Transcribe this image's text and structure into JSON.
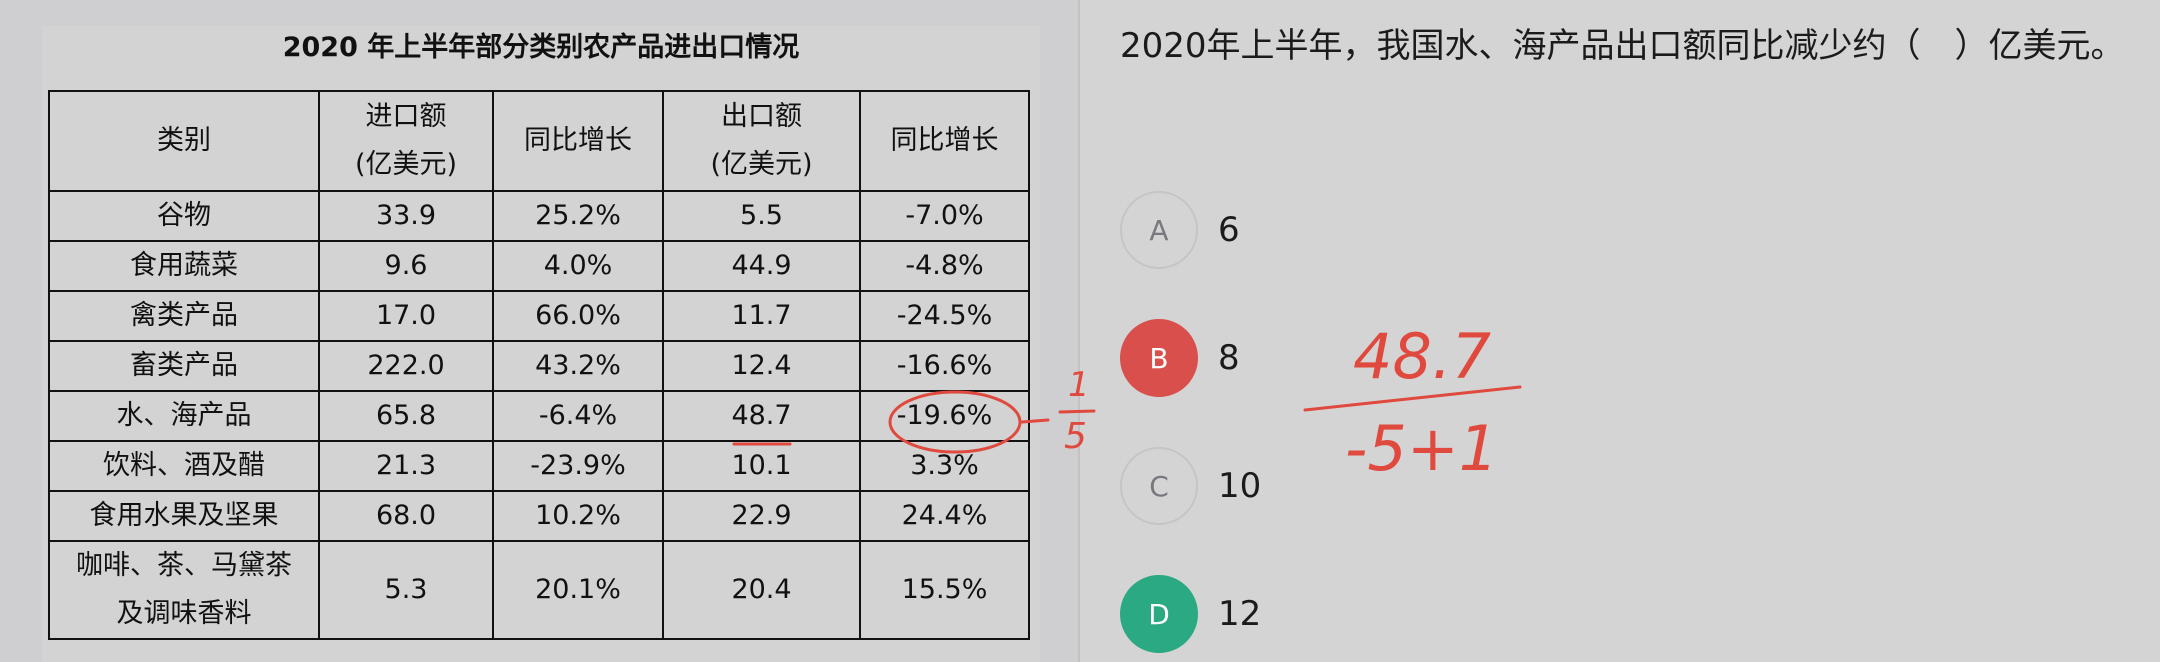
{
  "table": {
    "title": "2020 年上半年部分类别农产品进出口情况",
    "headers": [
      {
        "line1": "类别",
        "line2": ""
      },
      {
        "line1": "进口额",
        "line2": "(亿美元)"
      },
      {
        "line1": "同比增长",
        "line2": ""
      },
      {
        "line1": "出口额",
        "line2": "(亿美元)"
      },
      {
        "line1": "同比增长",
        "line2": ""
      }
    ],
    "rows": [
      [
        "谷物",
        "33.9",
        "25.2%",
        "5.5",
        "-7.0%"
      ],
      [
        "食用蔬菜",
        "9.6",
        "4.0%",
        "44.9",
        "-4.8%"
      ],
      [
        "禽类产品",
        "17.0",
        "66.0%",
        "11.7",
        "-24.5%"
      ],
      [
        "畜类产品",
        "222.0",
        "43.2%",
        "12.4",
        "-16.6%"
      ],
      [
        "水、海产品",
        "65.8",
        "-6.4%",
        "48.7",
        "-19.6%"
      ],
      [
        "饮料、酒及醋",
        "21.3",
        "-23.9%",
        "10.1",
        "3.3%"
      ],
      [
        "食用水果及坚果",
        "68.0",
        "10.2%",
        "22.9",
        "24.4%"
      ]
    ],
    "last_row": {
      "category_line1": "咖啡、茶、马黛茶",
      "category_line2": "及调味香料",
      "cells": [
        "5.3",
        "20.1%",
        "20.4",
        "15.5%"
      ]
    }
  },
  "question": {
    "text": "2020年上半年，我国水、海产品出口额同比减少约（　）亿美元。"
  },
  "options": [
    {
      "letter": "A",
      "value": "6",
      "state": "default"
    },
    {
      "letter": "B",
      "value": "8",
      "state": "wrong"
    },
    {
      "letter": "C",
      "value": "10",
      "state": "default"
    },
    {
      "letter": "D",
      "value": "12",
      "state": "correct"
    }
  ],
  "colors": {
    "wrong": "#d94f4c",
    "correct": "#2aa983",
    "ink": "#e0493d"
  },
  "handwriting": {
    "fraction_num": "1",
    "fraction_den": "5",
    "calc_top": "48.7",
    "calc_bottom": "-5+1"
  }
}
